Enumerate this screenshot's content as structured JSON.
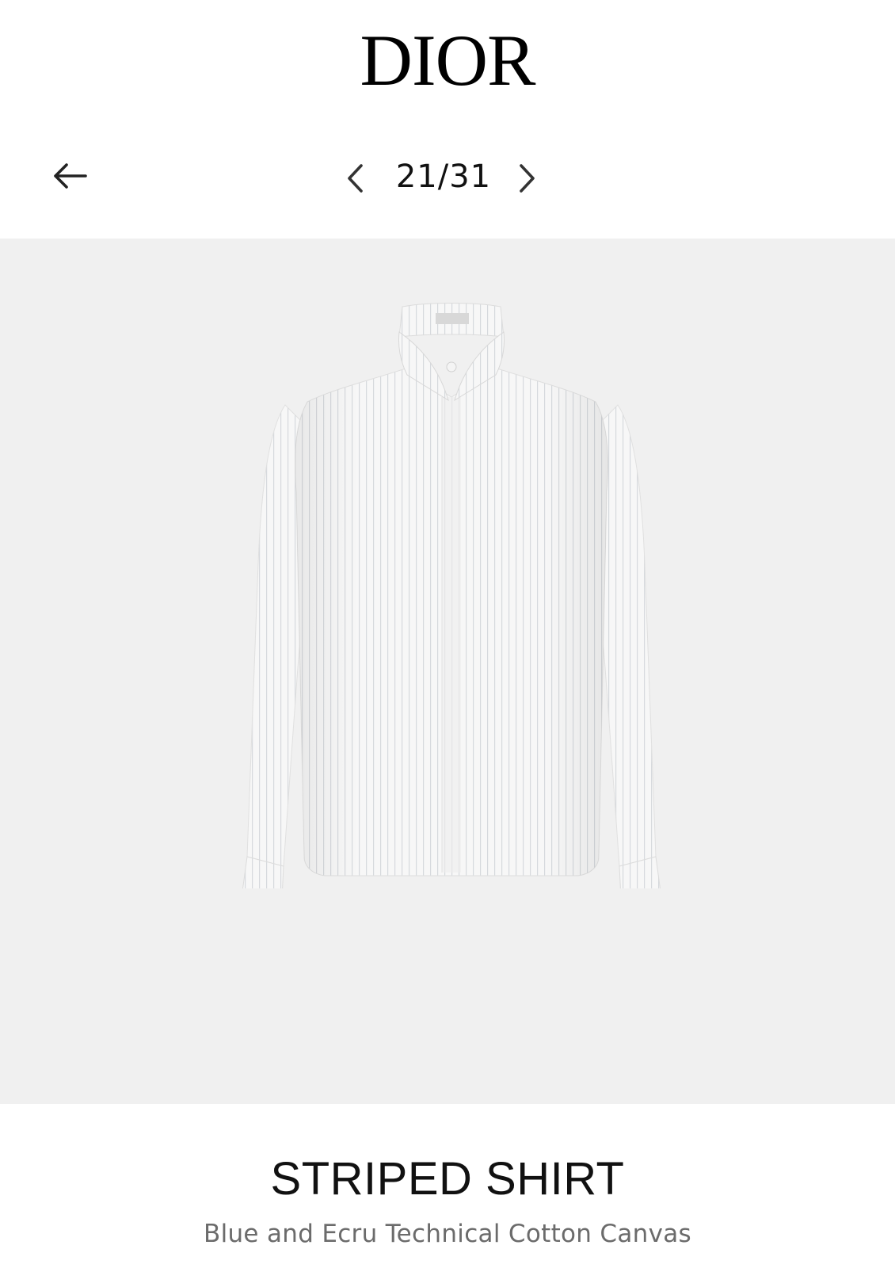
{
  "header": {
    "brand": "DIOR"
  },
  "nav": {
    "back_icon": "arrow-left-icon",
    "prev_icon": "chevron-left-icon",
    "next_icon": "chevron-right-icon",
    "counter": "21/31"
  },
  "product": {
    "title": "STRIPED SHIRT",
    "subtitle": "Blue and Ecru Technical Cotton Canvas"
  },
  "colors": {
    "background": "#ffffff",
    "stage_background": "#f0f0f0",
    "text_primary": "#111111",
    "text_secondary": "#6b6b6b"
  }
}
